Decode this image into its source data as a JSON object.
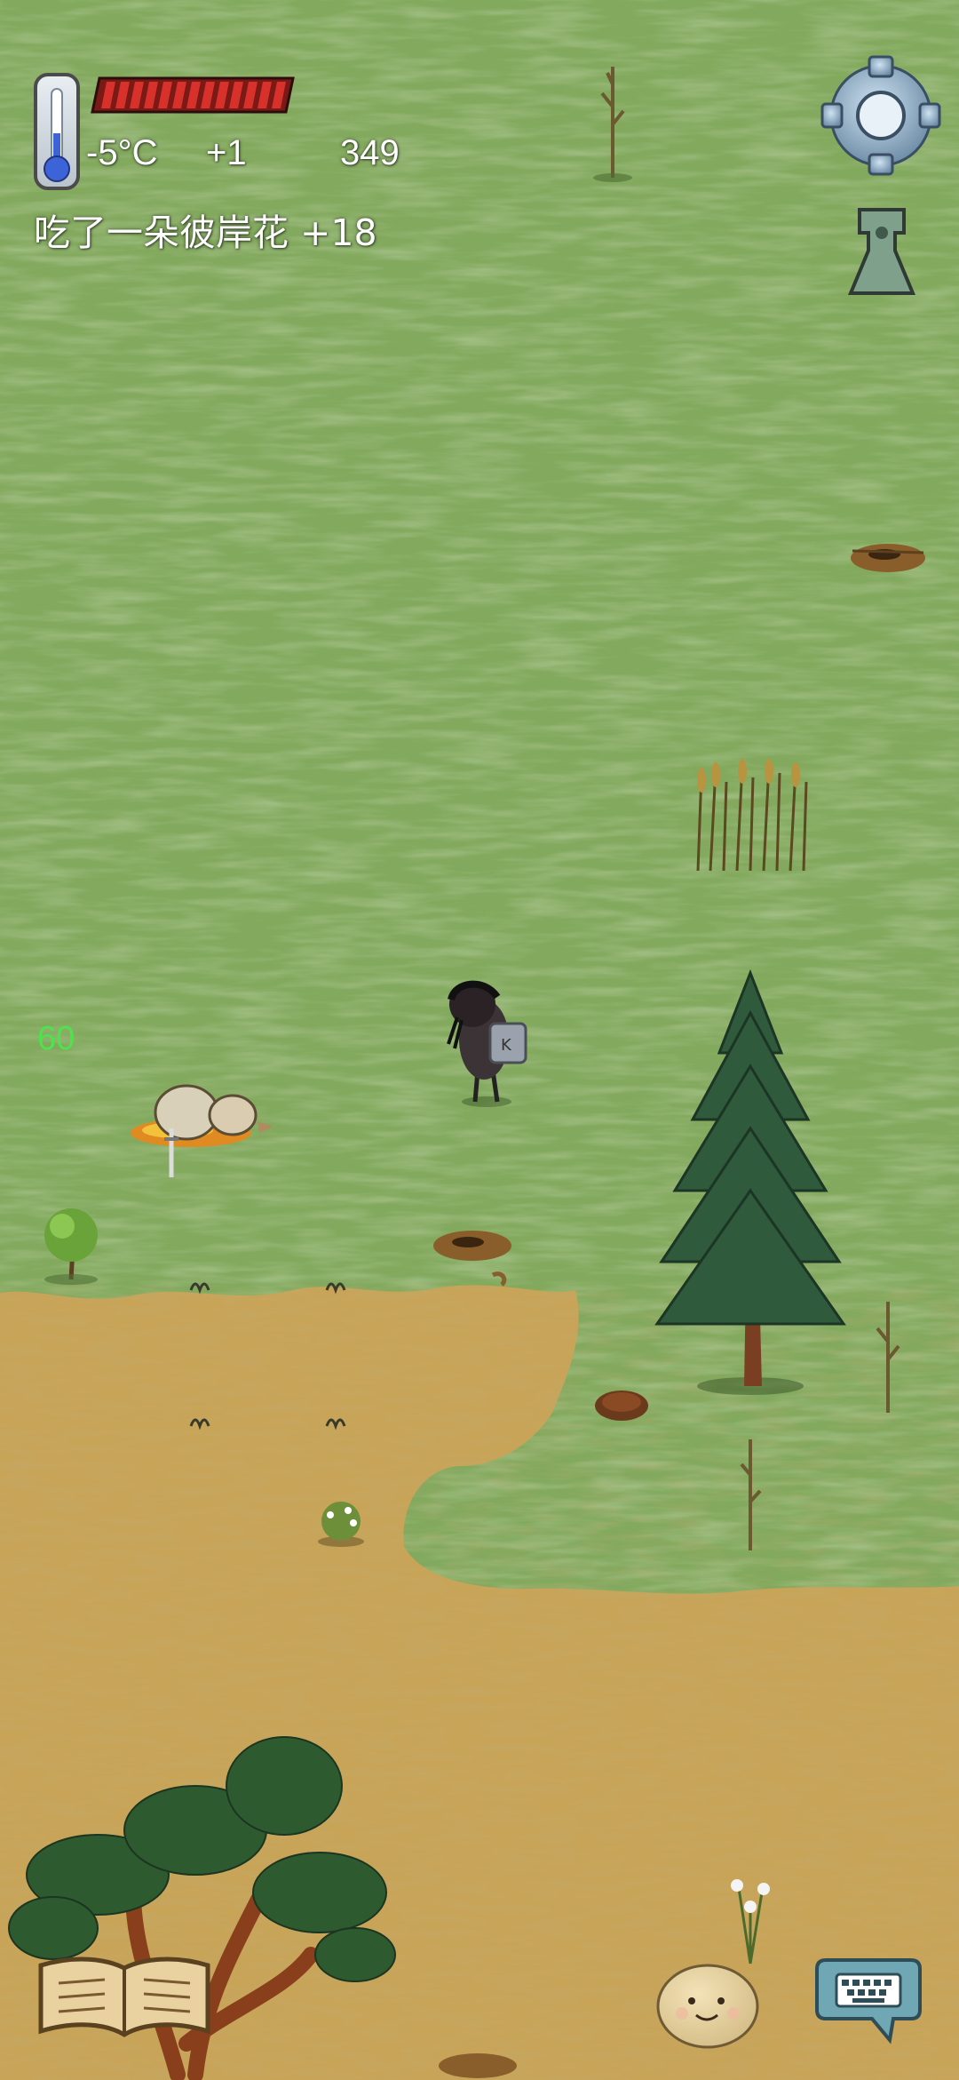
{
  "hud": {
    "temperature": "-5°C",
    "temperature_delta": "+1",
    "age_counter": "349",
    "health_fraction": 1.0,
    "health_color": "#d8302a"
  },
  "status_message": "吃了一朵彼岸花 +18",
  "debug_number": "60",
  "buttons": {
    "settings": "gear-icon",
    "coin": "spade-coin-icon",
    "recipe_book": "book-icon",
    "emote": "smiley-face-icon",
    "chat": "keyboard-chat-icon"
  },
  "colors": {
    "grass": "#86ad62",
    "dry_grass": "#c9a85a",
    "debug_text": "#4ee34e"
  }
}
